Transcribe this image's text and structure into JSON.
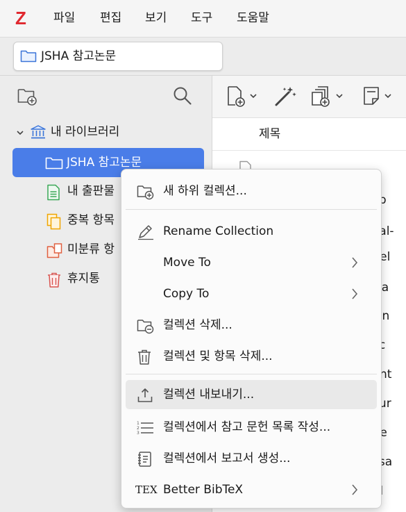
{
  "app": {
    "logo": "Z",
    "menus": [
      "파일",
      "편집",
      "보기",
      "도구",
      "도움말"
    ]
  },
  "tab": {
    "label": "JSHA 참고논문"
  },
  "sidebar": {
    "tree": [
      {
        "label": "내 라이브러리",
        "icon": "library-icon"
      },
      {
        "label": "JSHA 참고논문",
        "icon": "folder-icon",
        "selected": true
      },
      {
        "label": "내 출판물",
        "icon": "my-publications-icon"
      },
      {
        "label": "중복 항목",
        "icon": "duplicate-items-icon"
      },
      {
        "label": "미분류 항",
        "icon": "unfiled-items-icon"
      },
      {
        "label": "휴지통",
        "icon": "trash-icon"
      }
    ]
  },
  "items": {
    "column_title": "제목",
    "row_fragments": [
      "resp",
      "pinal-",
      "al rel",
      ", is a",
      "fican",
      "anic",
      "ment",
      "ostur",
      "nme",
      "niosa",
      "and"
    ]
  },
  "context_menu": {
    "items": [
      {
        "label": "새 하위 컬렉션...",
        "icon": "new-subcollection-icon"
      },
      {
        "label": "Rename Collection",
        "icon": "rename-icon"
      },
      {
        "label": "Move To",
        "icon": "",
        "submenu": true
      },
      {
        "label": "Copy To",
        "icon": "",
        "submenu": true
      },
      {
        "label": "컬렉션 삭제...",
        "icon": "delete-collection-icon"
      },
      {
        "label": "컬렉션 및 항목 삭제...",
        "icon": "trash-icon"
      },
      {
        "label": "컬렉션 내보내기...",
        "icon": "export-icon",
        "highlighted": true
      },
      {
        "label": "컬렉션에서 참고 문헌 목록 작성...",
        "icon": "bibliography-icon"
      },
      {
        "label": "컬렉션에서 보고서 생성...",
        "icon": "report-icon"
      },
      {
        "label": "Better BibTeX",
        "icon": "tex-icon",
        "submenu": true
      }
    ],
    "tex_glyph": "TEX"
  },
  "colors": {
    "accent": "#4a7de8",
    "logo": "#e0282f",
    "pub_green": "#3aa757",
    "dup_orange": "#f0a500",
    "unfiled_red": "#e06040",
    "trash_red": "#d9534f"
  }
}
